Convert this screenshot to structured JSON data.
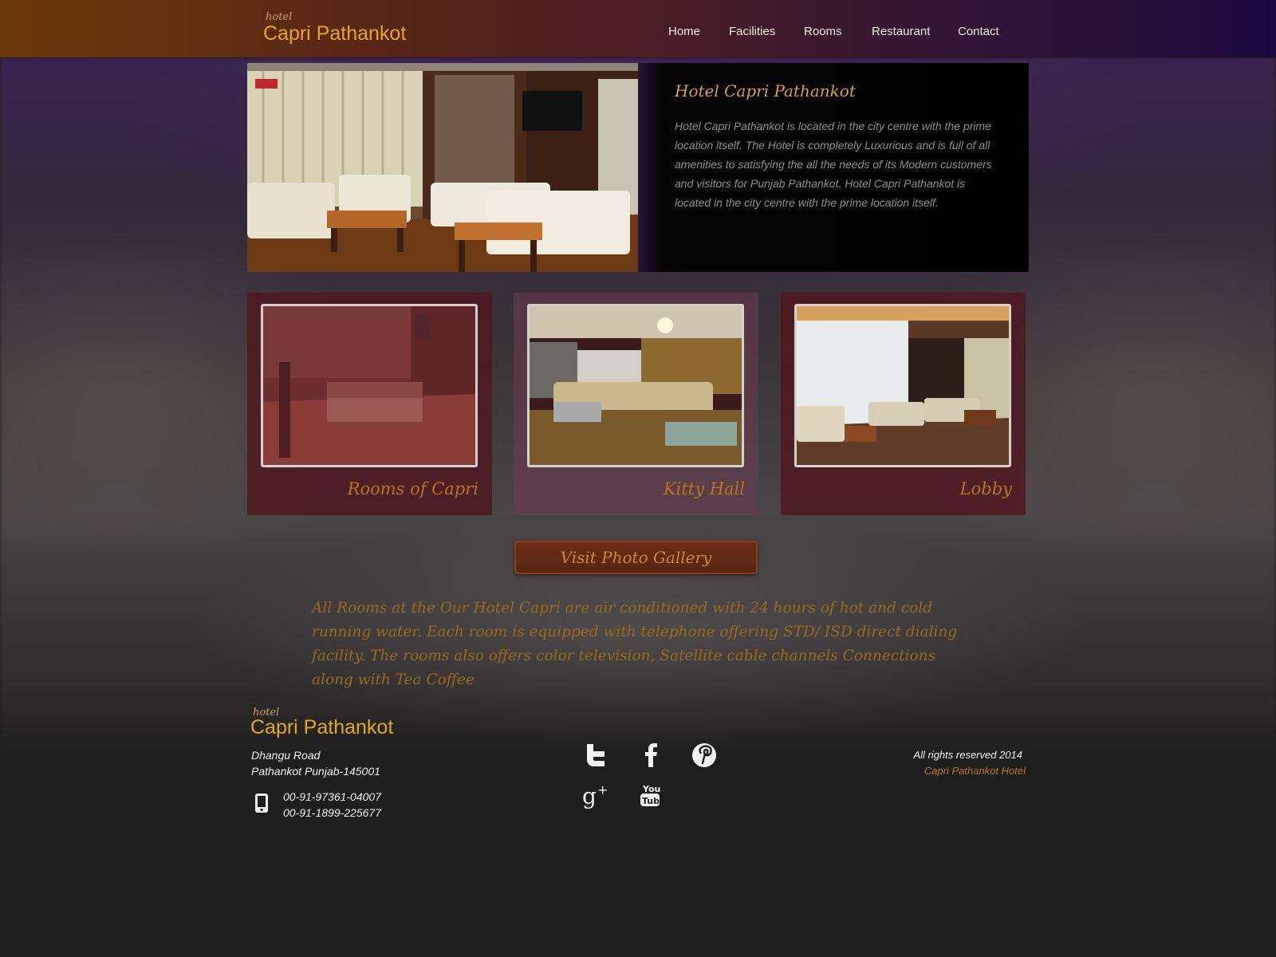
{
  "header": {
    "logo_small": "hotel",
    "logo_big": "Capri Pathankot",
    "nav": [
      "Home",
      "Facilities",
      "Rooms",
      "Restaurant",
      "Contact"
    ]
  },
  "hero": {
    "title": "Hotel Capri Pathankot",
    "paragraph": "Hotel Capri Pathankot is located in the city centre with the prime location itself. The Hotel is completely Luxurious and is full of all amenities to satisfying the all the needs of its Modern customers and visitors for Punjab Pathankot. Hotel Capri Pathankot is located in the city centre with the prime location itself."
  },
  "cards": [
    {
      "caption": "Rooms of Capri"
    },
    {
      "caption": "Kitty Hall"
    },
    {
      "caption": "Lobby"
    }
  ],
  "gallery_button": "Visit Photo Gallery",
  "rooms_text": "All Rooms at the Our Hotel Capri are air conditioned with 24 hours of hot and cold running water. Each room is equipped with telephone offering STD/ ISD direct dialing facility. The rooms also offers color television, Satellite cable channels Connections along with Tea Coffee",
  "footer": {
    "logo_small": "hotel",
    "logo_big": "Capri Pathankot",
    "address_line1": "Dhangu Road",
    "address_line2": "Pathankot Punjab-145001",
    "phone1": "00-91-97361-04007",
    "phone2": "00-91-1899-225677",
    "rights": "All rights reserved 2014",
    "hotel_name": "Capri Pathankot Hotel",
    "social_icons": [
      "twitter-icon",
      "facebook-icon",
      "pinterest-icon",
      "google-plus-icon",
      "youtube-icon"
    ],
    "youtube_label_top": "You",
    "youtube_label_bottom": "Tube"
  },
  "colors": {
    "accent_gold": "#e2a81e",
    "caption_brown": "#b5771f",
    "button_bg": "#6b2d14"
  }
}
